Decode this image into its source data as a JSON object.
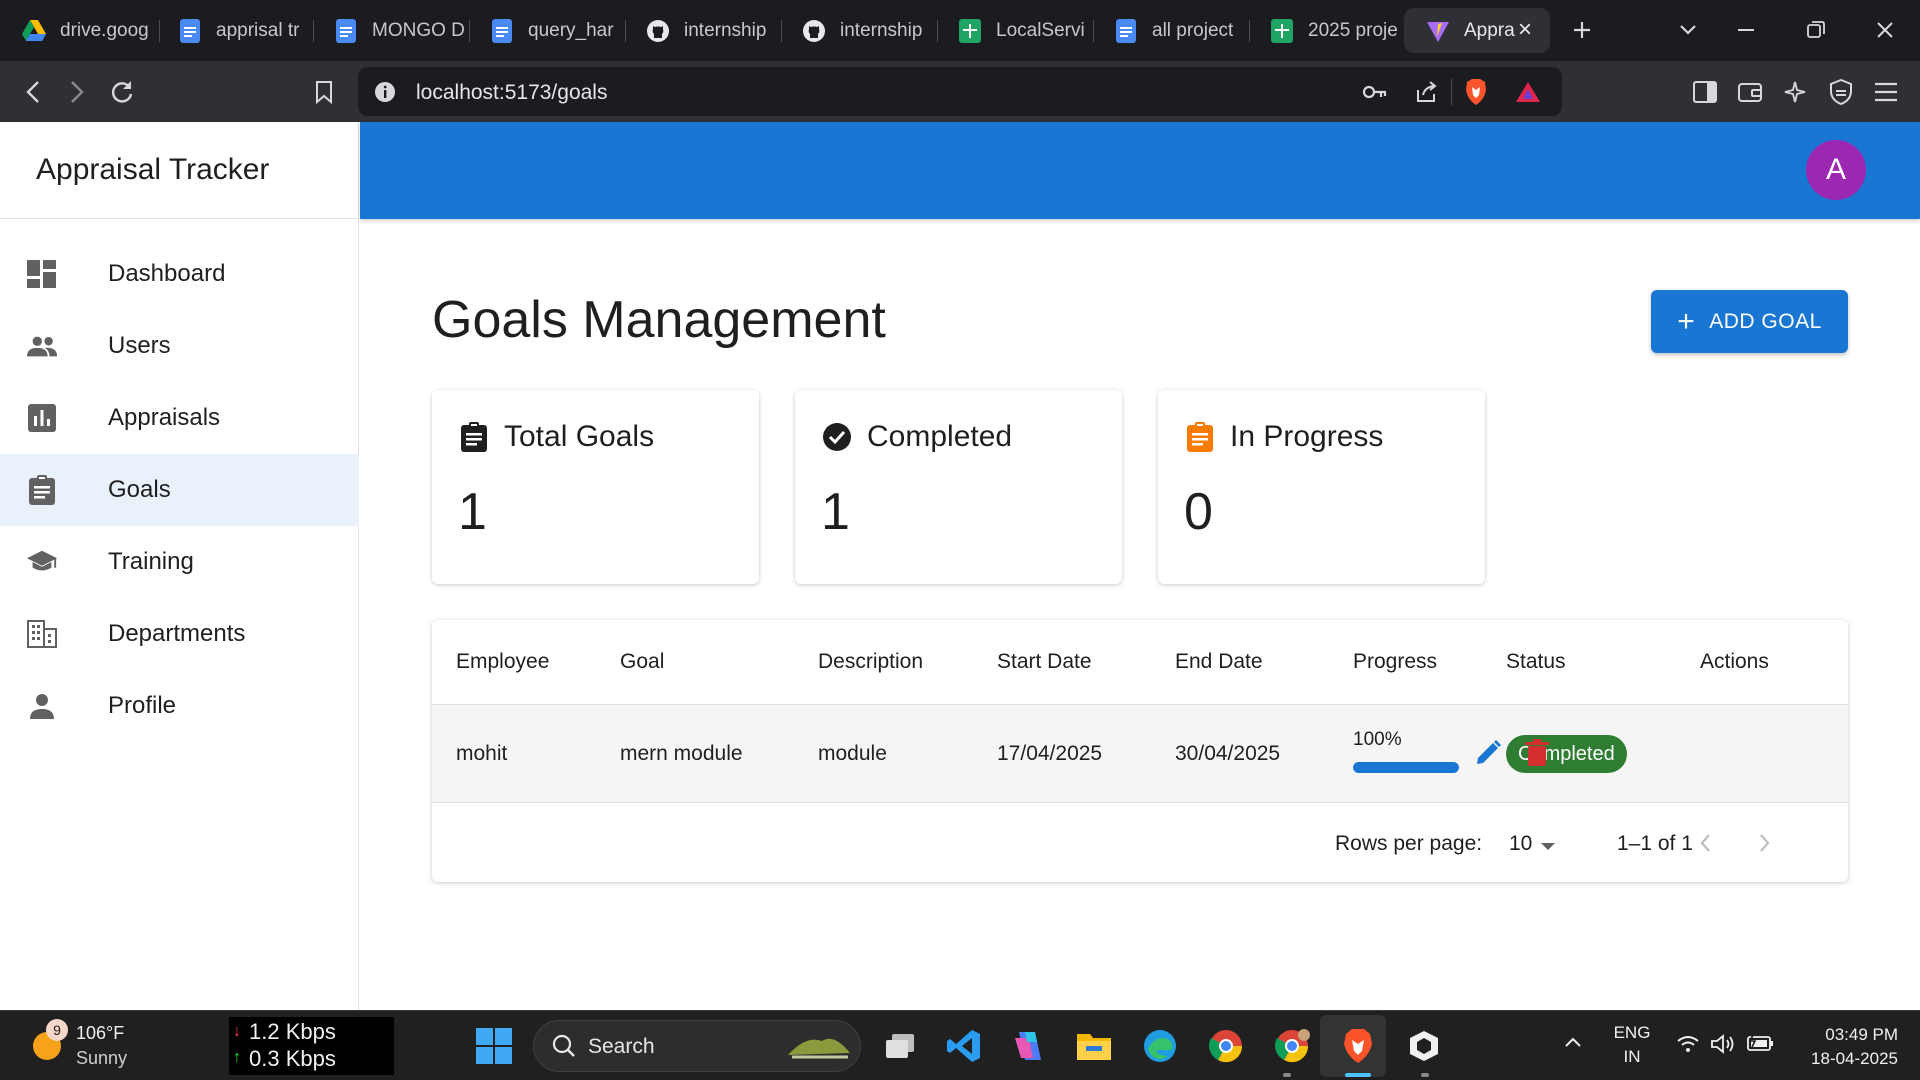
{
  "browser": {
    "tabs": [
      {
        "title": "drive.goog",
        "icon": "google-drive-icon"
      },
      {
        "title": "apprisal tr",
        "icon": "google-docs-icon"
      },
      {
        "title": "MONGO D",
        "icon": "google-docs-icon"
      },
      {
        "title": "query_har",
        "icon": "google-docs-icon"
      },
      {
        "title": "internship",
        "icon": "github-icon"
      },
      {
        "title": "internship",
        "icon": "github-icon"
      },
      {
        "title": "LocalServi",
        "icon": "google-sheets-icon"
      },
      {
        "title": "all project",
        "icon": "google-docs-icon"
      },
      {
        "title": "2025 proje",
        "icon": "google-sheets-icon"
      },
      {
        "title": "Appra",
        "icon": "vite-icon",
        "active": true
      }
    ],
    "url": "localhost:5173/goals"
  },
  "app": {
    "title": "Appraisal Tracker",
    "avatar_letter": "A",
    "nav": [
      {
        "label": "Dashboard",
        "icon": "dashboard-icon"
      },
      {
        "label": "Users",
        "icon": "users-icon"
      },
      {
        "label": "Appraisals",
        "icon": "bar-chart-icon"
      },
      {
        "label": "Goals",
        "icon": "clipboard-icon",
        "selected": true
      },
      {
        "label": "Training",
        "icon": "graduation-cap-icon"
      },
      {
        "label": "Departments",
        "icon": "building-icon"
      },
      {
        "label": "Profile",
        "icon": "person-icon"
      }
    ]
  },
  "page": {
    "title": "Goals Management",
    "add_button": "ADD GOAL",
    "stats": [
      {
        "label": "Total Goals",
        "value": "1",
        "icon": "clipboard-icon",
        "color": "#1f1f1f"
      },
      {
        "label": "Completed",
        "value": "1",
        "icon": "check-circle-icon",
        "color": "#1f1f1f"
      },
      {
        "label": "In Progress",
        "value": "0",
        "icon": "clipboard-icon",
        "color": "#f57c00"
      }
    ],
    "table": {
      "columns": [
        "Employee",
        "Goal",
        "Description",
        "Start Date",
        "End Date",
        "Progress",
        "Status",
        "Actions"
      ],
      "rows": [
        {
          "employee": "mohit",
          "goal": "mern module",
          "description": "module",
          "start_date": "17/04/2025",
          "end_date": "30/04/2025",
          "progress": 100,
          "progress_text": "100%",
          "status": "Completed"
        }
      ],
      "rows_per_page_label": "Rows per page:",
      "rows_per_page": "10",
      "page_info": "1–1 of 1"
    }
  },
  "colors": {
    "primary": "#1976d2",
    "avatar": "#9c27b0",
    "status_completed": "#2e7d32",
    "delete": "#d32f2f",
    "in_progress_icon": "#f57c00"
  },
  "taskbar": {
    "weather_badge": "9",
    "temperature": "106°F",
    "condition": "Sunny",
    "net_down": "1.2 Kbps",
    "net_up": "0.3 Kbps",
    "search_placeholder": "Search",
    "lang_top": "ENG",
    "lang_bottom": "IN",
    "time": "03:49 PM",
    "date": "18-04-2025"
  }
}
